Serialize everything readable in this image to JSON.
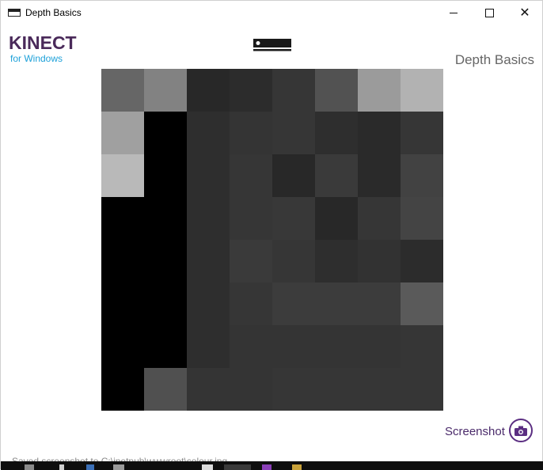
{
  "window": {
    "title": "Depth Basics",
    "app_icon": "window-app-icon",
    "controls": {
      "minimize_icon": "minimize-icon",
      "maximize_icon": "maximize-icon",
      "close_icon": "close-icon"
    }
  },
  "header": {
    "logo_main": "KINECT",
    "logo_sub": "for Windows",
    "sensor_icon": "kinect-sensor-icon",
    "heading": "Depth Basics"
  },
  "depth_image": {
    "grid_size": 8,
    "gray_levels": [
      [
        102,
        130,
        40,
        44,
        54,
        82,
        155,
        178
      ],
      [
        160,
        0,
        46,
        52,
        54,
        46,
        42,
        54
      ],
      [
        185,
        0,
        46,
        54,
        40,
        58,
        42,
        66
      ],
      [
        0,
        0,
        46,
        54,
        56,
        40,
        54,
        68
      ],
      [
        0,
        0,
        46,
        58,
        54,
        46,
        50,
        44
      ],
      [
        0,
        0,
        46,
        54,
        60,
        60,
        60,
        90
      ],
      [
        0,
        0,
        46,
        52,
        52,
        52,
        52,
        54
      ],
      [
        0,
        80,
        52,
        52,
        54,
        54,
        54,
        54
      ]
    ]
  },
  "actions": {
    "screenshot_label": "Screenshot",
    "screenshot_icon": "camera-icon"
  },
  "status": {
    "text": "Saved screenshot to C:\\inetpub\\wwwroot\\colour.jpg"
  },
  "colors": {
    "accent": "#5b2e82",
    "logo_text": "#4a2a5a",
    "logo_sub": "#1ea1d9"
  }
}
